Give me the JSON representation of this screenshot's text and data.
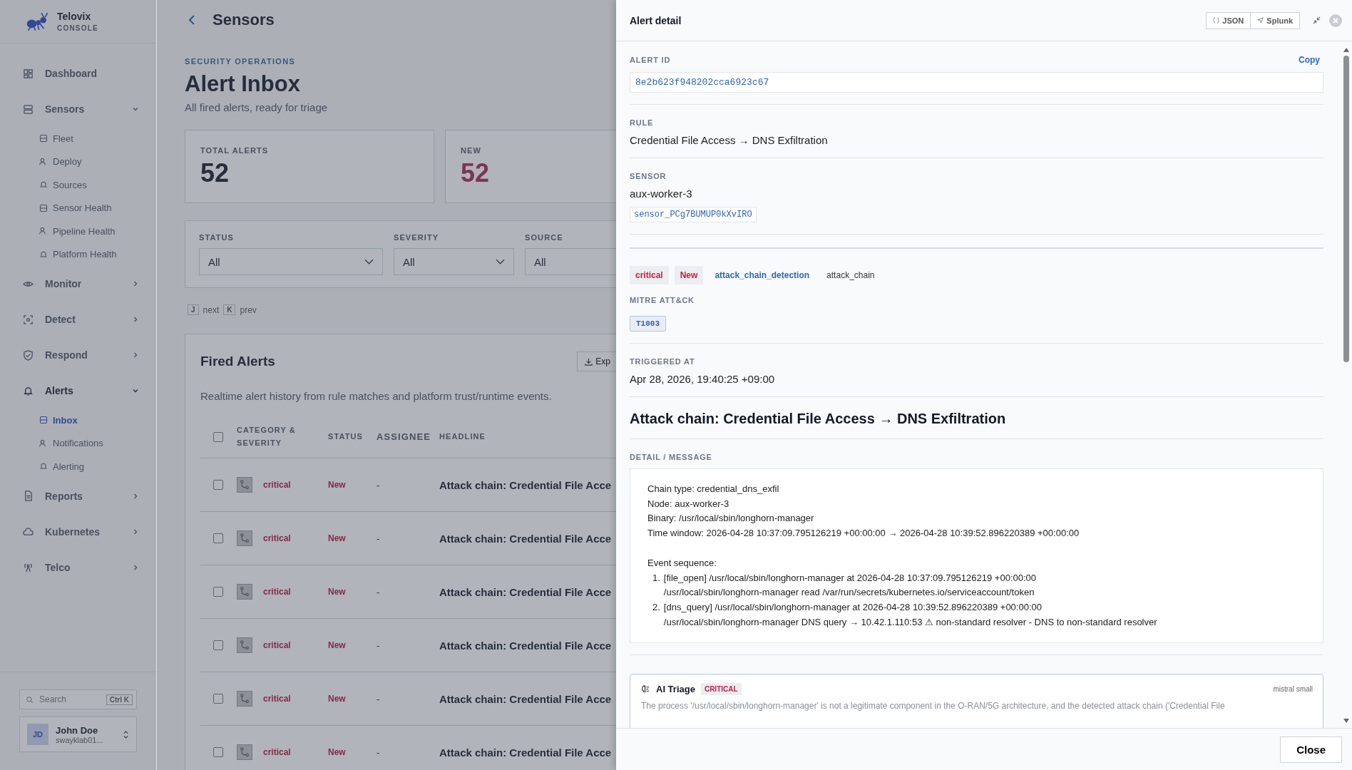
{
  "brand": {
    "name": "Telovix",
    "subtitle": "CONSOLE"
  },
  "nav": [
    {
      "label": "Dashboard",
      "expanded": false,
      "has_children": false
    },
    {
      "label": "Sensors",
      "expanded": true,
      "has_children": true,
      "children": [
        {
          "label": "Fleet",
          "selected": false
        },
        {
          "label": "Deploy",
          "selected": false
        },
        {
          "label": "Sources",
          "selected": false
        },
        {
          "label": "Sensor Health",
          "selected": false
        },
        {
          "label": "Pipeline Health",
          "selected": false
        },
        {
          "label": "Platform Health",
          "selected": false
        }
      ]
    },
    {
      "label": "Monitor",
      "expanded": false,
      "has_children": true
    },
    {
      "label": "Detect",
      "expanded": false,
      "has_children": true
    },
    {
      "label": "Respond",
      "expanded": false,
      "has_children": true
    },
    {
      "label": "Alerts",
      "expanded": true,
      "has_children": true,
      "children": [
        {
          "label": "Inbox",
          "selected": true
        },
        {
          "label": "Notifications",
          "selected": false
        },
        {
          "label": "Alerting",
          "selected": false
        }
      ]
    },
    {
      "label": "Reports",
      "expanded": false,
      "has_children": true
    },
    {
      "label": "Kubernetes",
      "expanded": false,
      "has_children": true
    },
    {
      "label": "Telco",
      "expanded": false,
      "has_children": true
    }
  ],
  "search": {
    "placeholder": "Search",
    "shortcut": "Ctrl K"
  },
  "user": {
    "initials": "JD",
    "name": "John Doe",
    "email": "swayklab01..."
  },
  "header": {
    "back_title": "Sensors"
  },
  "page": {
    "eyebrow": "SECURITY OPERATIONS",
    "title": "Alert Inbox",
    "subtitle": "All fired alerts, ready for triage"
  },
  "stats": [
    {
      "label": "TOTAL ALERTS",
      "value": "52",
      "kind": "total"
    },
    {
      "label": "NEW",
      "value": "52",
      "kind": "new"
    }
  ],
  "filters": [
    {
      "label": "STATUS",
      "value": "All"
    },
    {
      "label": "SEVERITY",
      "value": "All"
    },
    {
      "label": "SOURCE",
      "value": "All"
    }
  ],
  "shortcuts": [
    {
      "key": "J",
      "label": "next"
    },
    {
      "key": "K",
      "label": "prev"
    }
  ],
  "alerts_card": {
    "title": "Fired Alerts",
    "export_label": "Exp",
    "description": "Realtime alert history from rule matches and platform trust/runtime events."
  },
  "table": {
    "columns": [
      "CATEGORY & SEVERITY",
      "STATUS",
      "ASSIGNEE",
      "HEADLINE"
    ],
    "select_all_checked": false,
    "rows": [
      {
        "checked": false,
        "severity": "critical",
        "status": "New",
        "assignee": "-",
        "headline": "Attack chain: Credential File Acce"
      },
      {
        "checked": false,
        "severity": "critical",
        "status": "New",
        "assignee": "-",
        "headline": "Attack chain: Credential File Acce"
      },
      {
        "checked": false,
        "severity": "critical",
        "status": "New",
        "assignee": "-",
        "headline": "Attack chain: Credential File Acce"
      },
      {
        "checked": false,
        "severity": "critical",
        "status": "New",
        "assignee": "-",
        "headline": "Attack chain: Credential File Acce"
      },
      {
        "checked": false,
        "severity": "critical",
        "status": "New",
        "assignee": "-",
        "headline": "Attack chain: Credential File Acce"
      },
      {
        "checked": false,
        "severity": "critical",
        "status": "New",
        "assignee": "-",
        "headline": "Attack chain: Credential File Acce"
      }
    ]
  },
  "detail": {
    "title": "Alert detail",
    "actions": [
      "JSON",
      "Splunk"
    ],
    "alert_id_label": "ALERT ID",
    "copy_label": "Copy",
    "alert_id": "8e2b623f948202cca6923c67",
    "rule_label": "RULE",
    "rule": "Credential File Access → DNS Exfiltration",
    "sensor_label": "SENSOR",
    "sensor": "aux-worker-3",
    "sensor_id": "sensor_PCg7BUMUP0kXvIRO",
    "tags": [
      {
        "text": "critical",
        "kind": "severity"
      },
      {
        "text": "New",
        "kind": "status"
      },
      {
        "text": "attack_chain_detection",
        "kind": "link"
      },
      {
        "text": "attack_chain",
        "kind": "plain"
      }
    ],
    "mitre_label": "MITRE ATT&CK",
    "mitre": [
      "T1003"
    ],
    "triggered_label": "TRIGGERED AT",
    "triggered": "Apr 28, 2026, 19:40:25 +09:00",
    "headline": "Attack chain: Credential File Access → DNS Exfiltration",
    "message_label": "DETAIL / MESSAGE",
    "message_lines": [
      "Chain type: credential_dns_exfil",
      "Node: aux-worker-3",
      "Binary: /usr/local/sbin/longhorn-manager",
      "Time window: 2026-04-28 10:37:09.795126219 +00:00:00 → 2026-04-28 10:39:52.896220389 +00:00:00"
    ],
    "sequence_label": "Event sequence:",
    "steps": [
      {
        "number": "1.",
        "lines": [
          "[file_open] /usr/local/sbin/longhorn-manager at 2026-04-28 10:37:09.795126219 +00:00:00",
          "/usr/local/sbin/longhorn-manager read /var/run/secrets/kubernetes.io/serviceaccount/token"
        ]
      },
      {
        "number": "2.",
        "lines": [
          "[dns_query] /usr/local/sbin/longhorn-manager at 2026-04-28 10:39:52.896220389 +00:00:00",
          "/usr/local/sbin/longhorn-manager DNS query → 10.42.1.110:53 ⚠ non-standard resolver - DNS to non-standard resolver"
        ]
      }
    ],
    "triage": {
      "title": "AI Triage",
      "severity": "CRITICAL",
      "model": "mistral small",
      "text": "The process '/usr/local/sbin/longhorn-manager' is not a legitimate component in the O-RAN/5G architecture, and the detected attack chain ('Credential File"
    },
    "close_label": "Close"
  }
}
